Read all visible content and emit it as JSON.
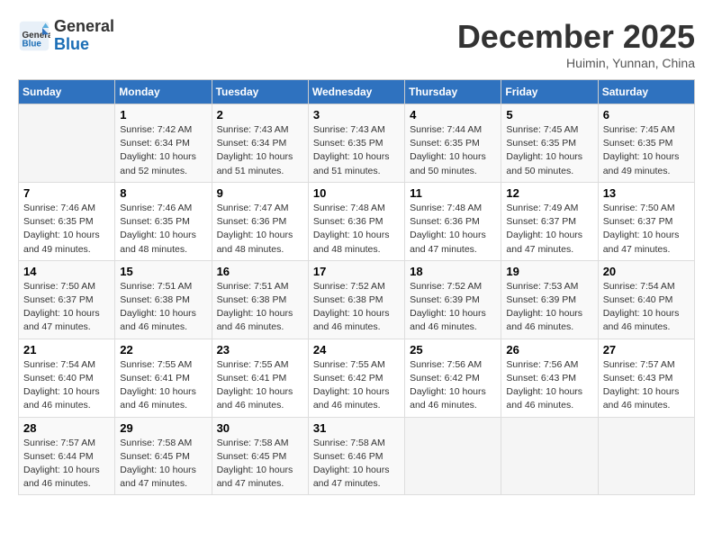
{
  "header": {
    "logo_line1": "General",
    "logo_line2": "Blue",
    "month": "December 2025",
    "location": "Huimin, Yunnan, China"
  },
  "weekdays": [
    "Sunday",
    "Monday",
    "Tuesday",
    "Wednesday",
    "Thursday",
    "Friday",
    "Saturday"
  ],
  "weeks": [
    [
      {
        "day": "",
        "sunrise": "",
        "sunset": "",
        "daylight": ""
      },
      {
        "day": "1",
        "sunrise": "7:42 AM",
        "sunset": "6:34 PM",
        "daylight": "10 hours and 52 minutes."
      },
      {
        "day": "2",
        "sunrise": "7:43 AM",
        "sunset": "6:34 PM",
        "daylight": "10 hours and 51 minutes."
      },
      {
        "day": "3",
        "sunrise": "7:43 AM",
        "sunset": "6:35 PM",
        "daylight": "10 hours and 51 minutes."
      },
      {
        "day": "4",
        "sunrise": "7:44 AM",
        "sunset": "6:35 PM",
        "daylight": "10 hours and 50 minutes."
      },
      {
        "day": "5",
        "sunrise": "7:45 AM",
        "sunset": "6:35 PM",
        "daylight": "10 hours and 50 minutes."
      },
      {
        "day": "6",
        "sunrise": "7:45 AM",
        "sunset": "6:35 PM",
        "daylight": "10 hours and 49 minutes."
      }
    ],
    [
      {
        "day": "7",
        "sunrise": "7:46 AM",
        "sunset": "6:35 PM",
        "daylight": "10 hours and 49 minutes."
      },
      {
        "day": "8",
        "sunrise": "7:46 AM",
        "sunset": "6:35 PM",
        "daylight": "10 hours and 48 minutes."
      },
      {
        "day": "9",
        "sunrise": "7:47 AM",
        "sunset": "6:36 PM",
        "daylight": "10 hours and 48 minutes."
      },
      {
        "day": "10",
        "sunrise": "7:48 AM",
        "sunset": "6:36 PM",
        "daylight": "10 hours and 48 minutes."
      },
      {
        "day": "11",
        "sunrise": "7:48 AM",
        "sunset": "6:36 PM",
        "daylight": "10 hours and 47 minutes."
      },
      {
        "day": "12",
        "sunrise": "7:49 AM",
        "sunset": "6:37 PM",
        "daylight": "10 hours and 47 minutes."
      },
      {
        "day": "13",
        "sunrise": "7:50 AM",
        "sunset": "6:37 PM",
        "daylight": "10 hours and 47 minutes."
      }
    ],
    [
      {
        "day": "14",
        "sunrise": "7:50 AM",
        "sunset": "6:37 PM",
        "daylight": "10 hours and 47 minutes."
      },
      {
        "day": "15",
        "sunrise": "7:51 AM",
        "sunset": "6:38 PM",
        "daylight": "10 hours and 46 minutes."
      },
      {
        "day": "16",
        "sunrise": "7:51 AM",
        "sunset": "6:38 PM",
        "daylight": "10 hours and 46 minutes."
      },
      {
        "day": "17",
        "sunrise": "7:52 AM",
        "sunset": "6:38 PM",
        "daylight": "10 hours and 46 minutes."
      },
      {
        "day": "18",
        "sunrise": "7:52 AM",
        "sunset": "6:39 PM",
        "daylight": "10 hours and 46 minutes."
      },
      {
        "day": "19",
        "sunrise": "7:53 AM",
        "sunset": "6:39 PM",
        "daylight": "10 hours and 46 minutes."
      },
      {
        "day": "20",
        "sunrise": "7:54 AM",
        "sunset": "6:40 PM",
        "daylight": "10 hours and 46 minutes."
      }
    ],
    [
      {
        "day": "21",
        "sunrise": "7:54 AM",
        "sunset": "6:40 PM",
        "daylight": "10 hours and 46 minutes."
      },
      {
        "day": "22",
        "sunrise": "7:55 AM",
        "sunset": "6:41 PM",
        "daylight": "10 hours and 46 minutes."
      },
      {
        "day": "23",
        "sunrise": "7:55 AM",
        "sunset": "6:41 PM",
        "daylight": "10 hours and 46 minutes."
      },
      {
        "day": "24",
        "sunrise": "7:55 AM",
        "sunset": "6:42 PM",
        "daylight": "10 hours and 46 minutes."
      },
      {
        "day": "25",
        "sunrise": "7:56 AM",
        "sunset": "6:42 PM",
        "daylight": "10 hours and 46 minutes."
      },
      {
        "day": "26",
        "sunrise": "7:56 AM",
        "sunset": "6:43 PM",
        "daylight": "10 hours and 46 minutes."
      },
      {
        "day": "27",
        "sunrise": "7:57 AM",
        "sunset": "6:43 PM",
        "daylight": "10 hours and 46 minutes."
      }
    ],
    [
      {
        "day": "28",
        "sunrise": "7:57 AM",
        "sunset": "6:44 PM",
        "daylight": "10 hours and 46 minutes."
      },
      {
        "day": "29",
        "sunrise": "7:58 AM",
        "sunset": "6:45 PM",
        "daylight": "10 hours and 47 minutes."
      },
      {
        "day": "30",
        "sunrise": "7:58 AM",
        "sunset": "6:45 PM",
        "daylight": "10 hours and 47 minutes."
      },
      {
        "day": "31",
        "sunrise": "7:58 AM",
        "sunset": "6:46 PM",
        "daylight": "10 hours and 47 minutes."
      },
      {
        "day": "",
        "sunrise": "",
        "sunset": "",
        "daylight": ""
      },
      {
        "day": "",
        "sunrise": "",
        "sunset": "",
        "daylight": ""
      },
      {
        "day": "",
        "sunrise": "",
        "sunset": "",
        "daylight": ""
      }
    ]
  ],
  "labels": {
    "sunrise": "Sunrise:",
    "sunset": "Sunset:",
    "daylight": "Daylight:"
  }
}
